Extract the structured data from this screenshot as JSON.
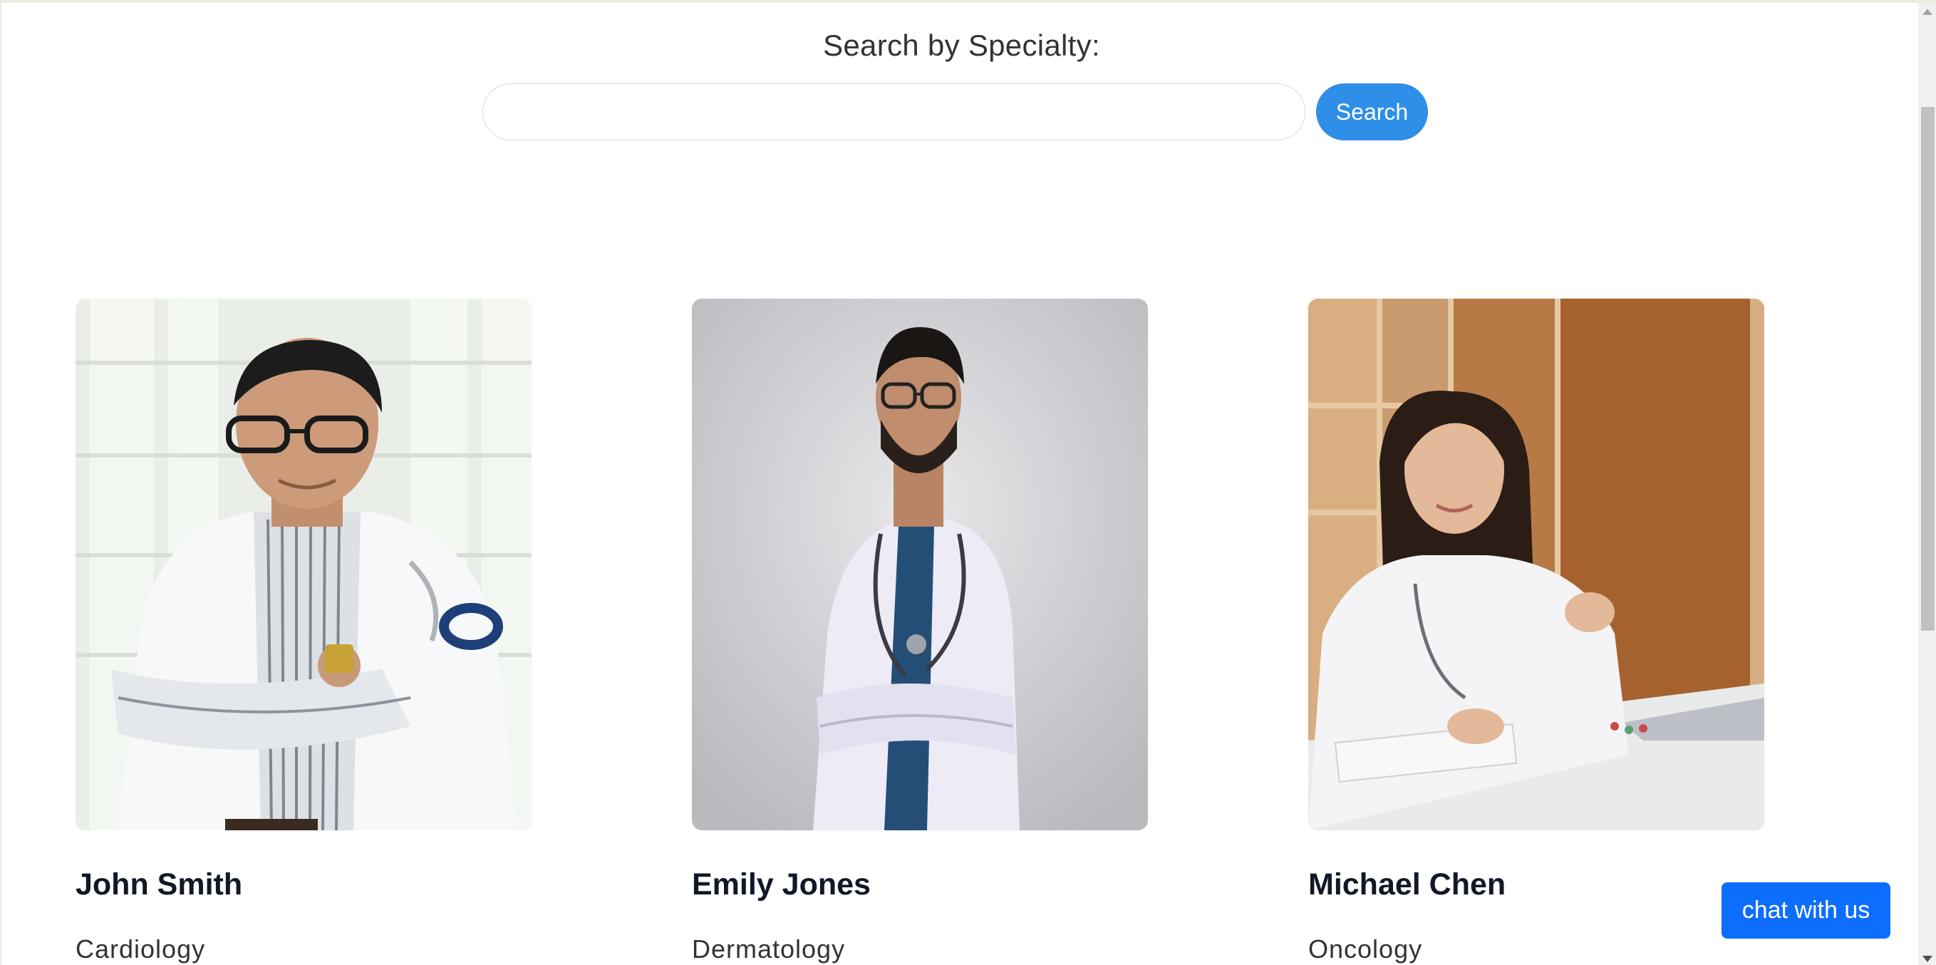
{
  "search": {
    "heading": "Search by Specialty:",
    "input_value": "",
    "placeholder": "",
    "button_label": "Search"
  },
  "doctors": [
    {
      "name": "John Smith",
      "specialty": "Cardiology",
      "photo_icon": "doctor-photo-icon"
    },
    {
      "name": "Emily Jones",
      "specialty": "Dermatology",
      "photo_icon": "doctor-photo-icon"
    },
    {
      "name": "Michael Chen",
      "specialty": "Oncology",
      "photo_icon": "doctor-photo-icon"
    }
  ],
  "chat": {
    "label": "chat with us"
  },
  "colors": {
    "search_button": "#2f8ee8",
    "chat_button": "#0d6efd",
    "name_text": "#111827",
    "body_text": "#333333"
  }
}
